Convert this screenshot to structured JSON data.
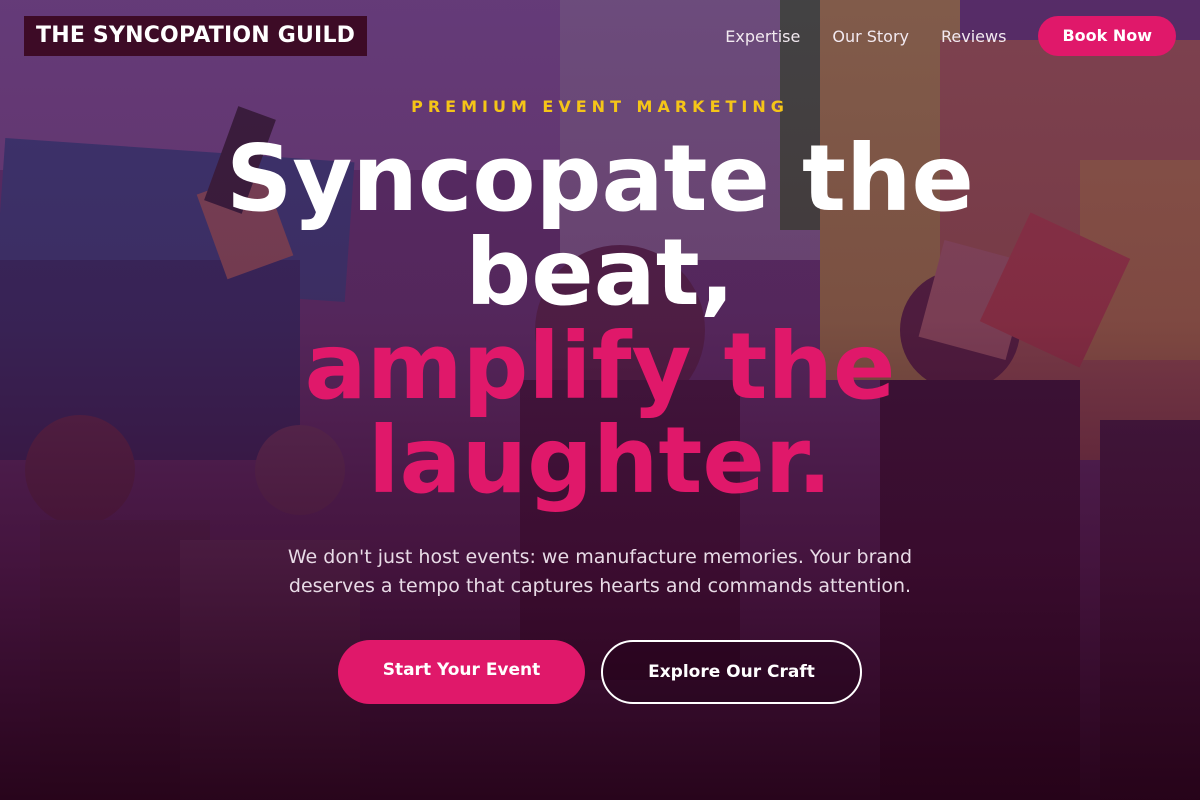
{
  "brand": {
    "name": "THE SYNCOPATION GUILD"
  },
  "nav": {
    "links": [
      "Expertise",
      "Our Story",
      "Reviews"
    ],
    "cta": "Book Now"
  },
  "hero": {
    "eyebrow": "PREMIUM EVENT MARKETING",
    "headline_line1": "Syncopate the beat,",
    "headline_line2": "amplify the laughter.",
    "subtext": "We don't just host events: we manufacture memories. Your brand deserves a tempo that captures hearts and commands attention.",
    "primary_cta": "Start Your Event",
    "secondary_cta": "Explore Our Craft"
  },
  "colors": {
    "accent": "#e0186a",
    "eyebrow": "#f5c518",
    "logo_bg": "#3d0b26"
  }
}
